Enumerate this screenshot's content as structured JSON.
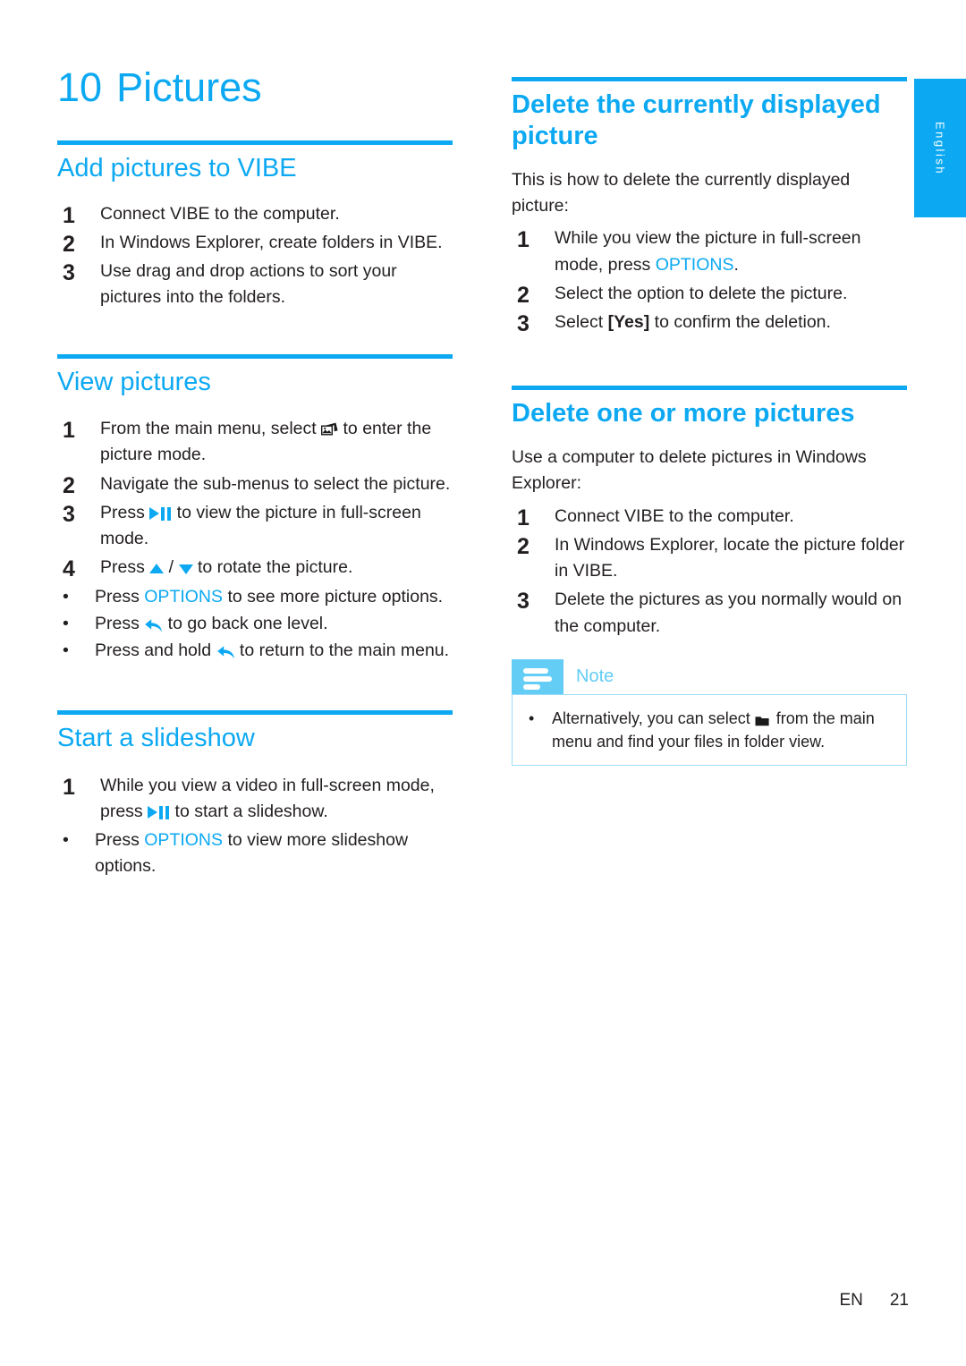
{
  "language_tab": {
    "label": "English"
  },
  "chapter": {
    "number": "10",
    "title": "Pictures"
  },
  "left_column": {
    "sections": [
      {
        "heading": "Add pictures to VIBE",
        "steps": [
          {
            "n": "1",
            "text": "Connect VIBE to the computer."
          },
          {
            "n": "2",
            "text": "In Windows Explorer, create folders in VIBE."
          },
          {
            "n": "3",
            "text": "Use drag and drop actions to sort your pictures into the folders."
          }
        ]
      },
      {
        "heading": "View pictures",
        "steps": [
          {
            "n": "1",
            "pre": "From the main menu, select ",
            "icon": "picture-mode-icon",
            "post": " to enter the picture mode."
          },
          {
            "n": "2",
            "pre": "Navigate the sub-menus to select the picture.",
            "icon": "",
            "post": ""
          },
          {
            "n": "3",
            "pre": "Press ",
            "icon": "play-pause-icon",
            "post": " to view the picture in full-screen mode."
          },
          {
            "n": "4",
            "pre": "Press ",
            "icon": "up-down-arrows-icon",
            "post": " to rotate the picture."
          }
        ],
        "bullets": [
          {
            "pre": "Press ",
            "emph": "OPTIONS",
            "post": " to see more picture options.",
            "icon": ""
          },
          {
            "pre": "Press ",
            "icon": "back-arrow-icon",
            "post": " to go back one level."
          },
          {
            "pre": "Press and hold ",
            "icon": "back-arrow-icon",
            "post": " to return to the main menu."
          }
        ]
      },
      {
        "heading": "Start a slideshow",
        "steps": [
          {
            "n": "1",
            "pre": "While you view a video in full-screen mode, press ",
            "icon": "play-pause-icon",
            "post": " to start a slideshow."
          }
        ],
        "bullets": [
          {
            "pre": "Press ",
            "emph": "OPTIONS",
            "post": " to view more slideshow options."
          }
        ]
      }
    ]
  },
  "right_column": {
    "sections": [
      {
        "heading": "Delete the currently displayed picture",
        "intro": "This is how to delete the currently displayed picture:",
        "steps": [
          {
            "n": "1",
            "pre": "While you view the picture in full-screen mode, press ",
            "emph": "OPTIONS",
            "post": "."
          },
          {
            "n": "2",
            "pre": "Select the option to delete the picture.",
            "emph": "",
            "post": ""
          },
          {
            "n": "3",
            "pre": "Select ",
            "key": "[Yes]",
            "post": " to confirm the deletion."
          }
        ]
      },
      {
        "heading": "Delete one or more pictures",
        "intro": "Use a computer to delete pictures in Windows Explorer:",
        "steps": [
          {
            "n": "1",
            "text": "Connect VIBE to the computer."
          },
          {
            "n": "2",
            "text": "In Windows Explorer, locate the picture folder in VIBE."
          },
          {
            "n": "3",
            "text": "Delete the pictures as you normally would on the computer."
          }
        ]
      }
    ],
    "note": {
      "title": "Note",
      "icon": "note-lines-icon",
      "bullet_pre": "Alternatively, you can select ",
      "bullet_icon": "folder-icon",
      "bullet_post": " from the main menu and find your files in folder view."
    }
  },
  "footer": {
    "language_code": "EN",
    "page_number": "21"
  },
  "colors": {
    "accent": "#0ca9f2",
    "note_tab": "#63cdf5",
    "note_border": "#9fdcf6",
    "text": "#231f20"
  }
}
